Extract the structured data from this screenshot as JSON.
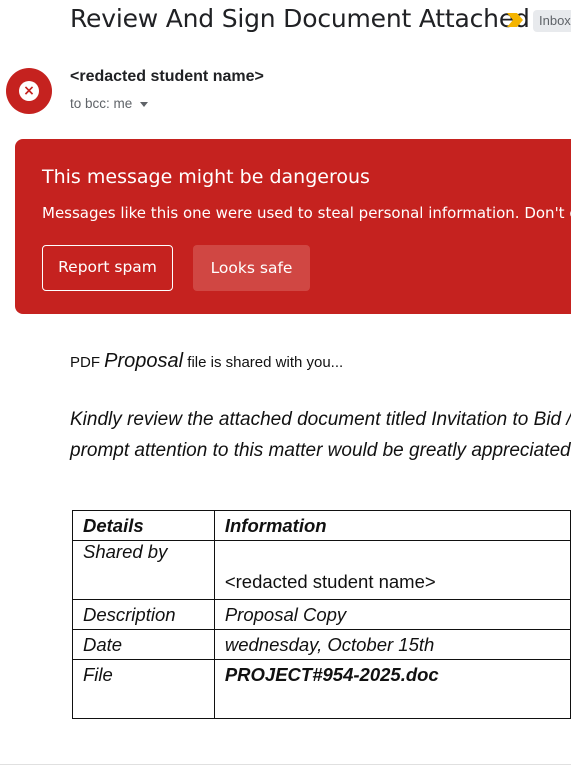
{
  "header": {
    "subject": "Review And Sign Document Attached",
    "label_chip": "Inbox",
    "important_icon": "important-marker-icon"
  },
  "sender": {
    "name": "<redacted student name>",
    "recipients": "to bcc: me",
    "avatar_icon": "blocked-sender-icon"
  },
  "warning": {
    "title": "This message might be dangerous",
    "body": "Messages like this one were used to steal personal information. Don't clic",
    "report_spam": "Report spam",
    "looks_safe": "Looks safe",
    "color": "#c5221f"
  },
  "body": {
    "line1_prefix": "PDF",
    "line1_em": "Proposal",
    "line1_suffix": "file is shared with you...",
    "para_line1": "Kindly review the attached document titled Invitation to Bid / R",
    "para_line2": "prompt attention to this matter would be greatly appreciated."
  },
  "table": {
    "headers": [
      "Details",
      "Information"
    ],
    "rows": [
      {
        "label": "Shared by",
        "value": "<redacted student name>"
      },
      {
        "label": "Description",
        "value": "Proposal Copy"
      },
      {
        "label": "Date",
        "value": "wednesday, October 15th"
      },
      {
        "label": "File",
        "value": "PROJECT#954-2025.doc"
      }
    ]
  }
}
